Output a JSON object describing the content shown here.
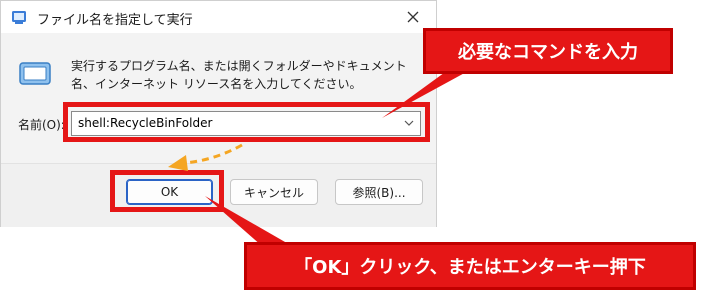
{
  "dialog": {
    "title": "ファイル名を指定して実行",
    "description": "実行するプログラム名、または開くフォルダーやドキュメント名、インターネット リソース名を入力してください。",
    "name_label": "名前(O):",
    "command_value": "shell:RecycleBinFolder",
    "buttons": {
      "ok": "OK",
      "cancel": "キャンセル",
      "browse": "参照(B)..."
    }
  },
  "annotations": {
    "callout_input": "必要なコマンドを入力",
    "callout_ok": "「OK」クリック、またはエンターキー押下"
  },
  "colors": {
    "annotation_red": "#e51616",
    "dashed_arrow": "#f5a623",
    "ok_focus_border": "#2a63c6"
  },
  "icons": [
    "run-app-icon",
    "close-icon",
    "monitor-icon",
    "chevron-down-icon"
  ]
}
